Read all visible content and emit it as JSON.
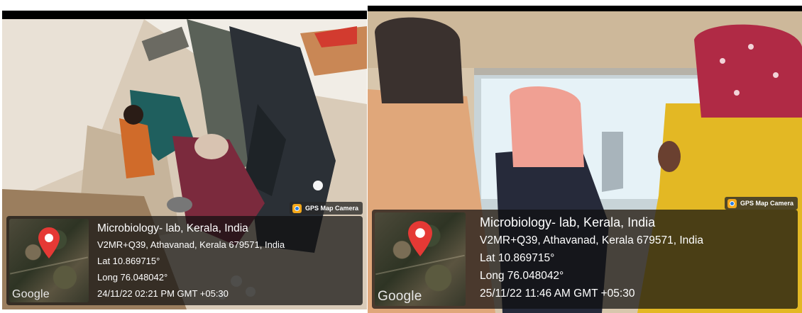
{
  "photos": [
    {
      "stamp": {
        "label": "GPS Map Camera",
        "icon": "gps-map-camera-icon"
      },
      "map": {
        "brand": "Google",
        "pin_icon": "map-pin-icon",
        "pin_color": "#e53935"
      },
      "location": {
        "title": "Microbiology- lab, Kerala, India",
        "address": "V2MR+Q39, Athavanad, Kerala 679571, India",
        "lat": "Lat 10.869715°",
        "long": "Long 76.048042°",
        "datetime": "24/11/22 02:21 PM GMT +05:30"
      }
    },
    {
      "stamp": {
        "label": "GPS Map Camera",
        "icon": "gps-map-camera-icon"
      },
      "map": {
        "brand": "Google",
        "pin_icon": "map-pin-icon",
        "pin_color": "#e53935"
      },
      "location": {
        "title": "Microbiology- lab, Kerala, India",
        "address": "V2MR+Q39, Athavanad, Kerala 679571, India",
        "lat": "Lat 10.869715°",
        "long": "Long 76.048042°",
        "datetime": "25/11/22 11:46 AM GMT +05:30"
      }
    }
  ]
}
